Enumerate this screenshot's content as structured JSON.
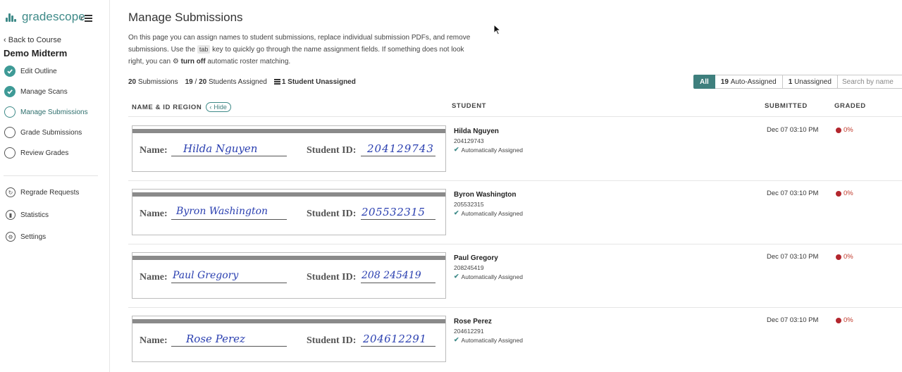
{
  "brand": {
    "name": "gradescope"
  },
  "sidebar": {
    "back_label": "Back to Course",
    "course_title": "Demo Midterm",
    "steps": [
      {
        "label": "Edit Outline",
        "state": "done"
      },
      {
        "label": "Manage Scans",
        "state": "done"
      },
      {
        "label": "Manage Submissions",
        "state": "current"
      },
      {
        "label": "Grade Submissions",
        "state": "todo"
      },
      {
        "label": "Review Grades",
        "state": "todo"
      }
    ],
    "links": [
      {
        "label": "Regrade Requests",
        "icon": "regrade-icon"
      },
      {
        "label": "Statistics",
        "icon": "statistics-icon"
      },
      {
        "label": "Settings",
        "icon": "gear-icon"
      }
    ]
  },
  "main": {
    "title": "Manage Submissions",
    "desc": {
      "p1": "On this page you can assign names to student submissions, replace individual submission PDFs, and remove submissions. Use the ",
      "kbd": "tab",
      "p2": " key to quickly go through the name assignment fields. If something does not look right, you can ",
      "link": "turn off",
      "p3": " automatic roster matching."
    },
    "stats": {
      "submissions_count": "20",
      "submissions_label": "Submissions",
      "assigned_count": "19",
      "assigned_sep": "/",
      "assigned_total": "20",
      "assigned_label": "Students Assigned",
      "unassigned_label": "1 Student Unassigned"
    },
    "filters": {
      "all": "All",
      "auto_count": "19",
      "auto_label": "Auto-Assigned",
      "unassigned_count": "1",
      "unassigned_label": "Unassigned"
    },
    "search": {
      "placeholder": "Search by name"
    },
    "columns": {
      "name_region": "NAME & ID REGION",
      "hide": "Hide",
      "student": "STUDENT",
      "submitted": "SUBMITTED",
      "graded": "GRADED"
    },
    "scan_labels": {
      "name": "Name:",
      "sid": "Student ID:"
    },
    "rows": [
      {
        "hand_name": "Hilda Nguyen",
        "hand_id": "204129743",
        "name": "Hilda Nguyen",
        "id": "204129743",
        "status": "Automatically Assigned",
        "submitted": "Dec 07 03:10 PM",
        "graded": "0%"
      },
      {
        "hand_name": "Byron Washington",
        "hand_id": "205532315",
        "name": "Byron Washington",
        "id": "205532315",
        "status": "Automatically Assigned",
        "submitted": "Dec 07 03:10 PM",
        "graded": "0%"
      },
      {
        "hand_name": "Paul Gregory",
        "hand_id": "208 245419",
        "name": "Paul Gregory",
        "id": "208245419",
        "status": "Automatically Assigned",
        "submitted": "Dec 07 03:10 PM",
        "graded": "0%"
      },
      {
        "hand_name": "Rose Perez",
        "hand_id": "204612291",
        "name": "Rose Perez",
        "id": "204612291",
        "status": "Automatically Assigned",
        "submitted": "Dec 07 03:10 PM",
        "graded": "0%"
      }
    ]
  },
  "colors": {
    "accent": "#3e8a88",
    "graded_dot": "#b3262d",
    "handwriting": "#2a3fb0"
  }
}
